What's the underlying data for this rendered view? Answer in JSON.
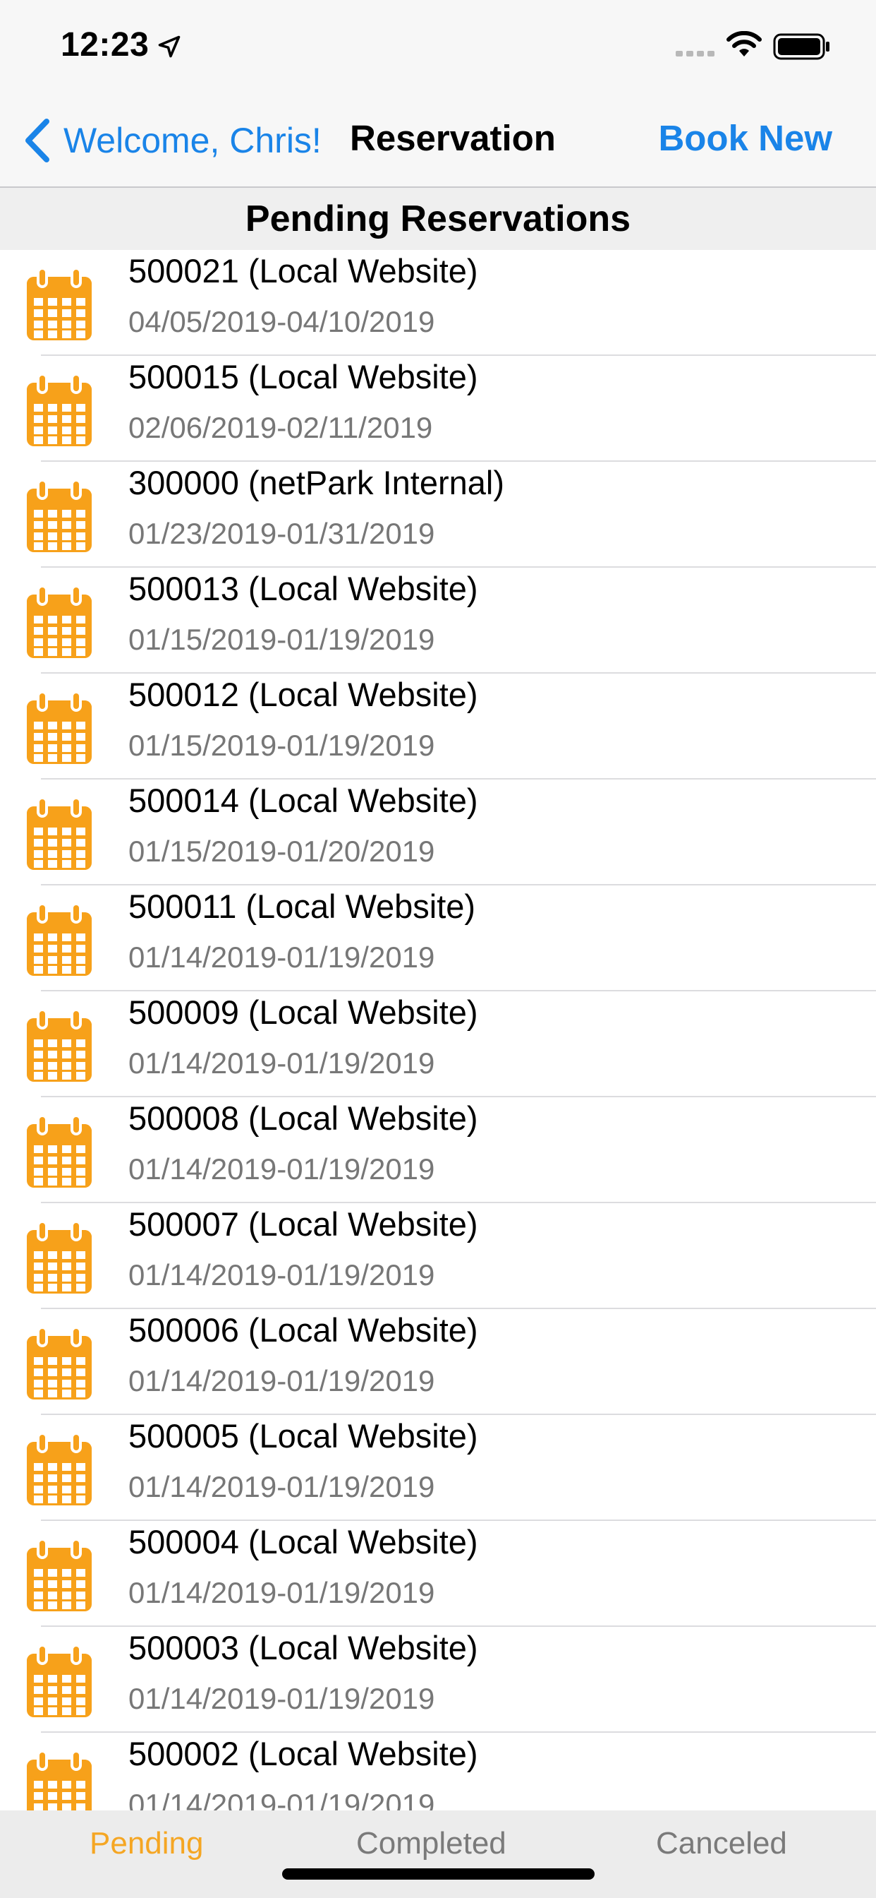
{
  "status_bar": {
    "time": "12:23",
    "location_icon": "location-arrow-icon",
    "signal_icon": "cellular-signal-icon",
    "wifi_icon": "wifi-icon",
    "battery_icon": "battery-icon"
  },
  "nav": {
    "back_label": "Welcome, Chris!",
    "title": "Reservation",
    "action_label": "Book New"
  },
  "section_title": "Pending Reservations",
  "reservations": [
    {
      "title": "500021 (Local Website)",
      "dates": "04/05/2019-04/10/2019"
    },
    {
      "title": "500015 (Local Website)",
      "dates": "02/06/2019-02/11/2019"
    },
    {
      "title": "300000 (netPark Internal)",
      "dates": "01/23/2019-01/31/2019"
    },
    {
      "title": "500013 (Local Website)",
      "dates": "01/15/2019-01/19/2019"
    },
    {
      "title": "500012 (Local Website)",
      "dates": "01/15/2019-01/19/2019"
    },
    {
      "title": "500014 (Local Website)",
      "dates": "01/15/2019-01/20/2019"
    },
    {
      "title": "500011 (Local Website)",
      "dates": "01/14/2019-01/19/2019"
    },
    {
      "title": "500009 (Local Website)",
      "dates": "01/14/2019-01/19/2019"
    },
    {
      "title": "500008 (Local Website)",
      "dates": "01/14/2019-01/19/2019"
    },
    {
      "title": "500007 (Local Website)",
      "dates": "01/14/2019-01/19/2019"
    },
    {
      "title": "500006 (Local Website)",
      "dates": "01/14/2019-01/19/2019"
    },
    {
      "title": "500005 (Local Website)",
      "dates": "01/14/2019-01/19/2019"
    },
    {
      "title": "500004 (Local Website)",
      "dates": "01/14/2019-01/19/2019"
    },
    {
      "title": "500003 (Local Website)",
      "dates": "01/14/2019-01/19/2019"
    },
    {
      "title": "500002 (Local Website)",
      "dates": "01/14/2019-01/19/2019"
    }
  ],
  "row_icon": "calendar-icon",
  "tabs": [
    {
      "label": "Pending",
      "selected": true
    },
    {
      "label": "Completed",
      "selected": false
    },
    {
      "label": "Canceled",
      "selected": false
    }
  ],
  "colors": {
    "accent_blue": "#1a84e8",
    "accent_orange": "#f5a623",
    "icon_orange": "#f7a11a",
    "subtitle_gray": "#777777"
  }
}
